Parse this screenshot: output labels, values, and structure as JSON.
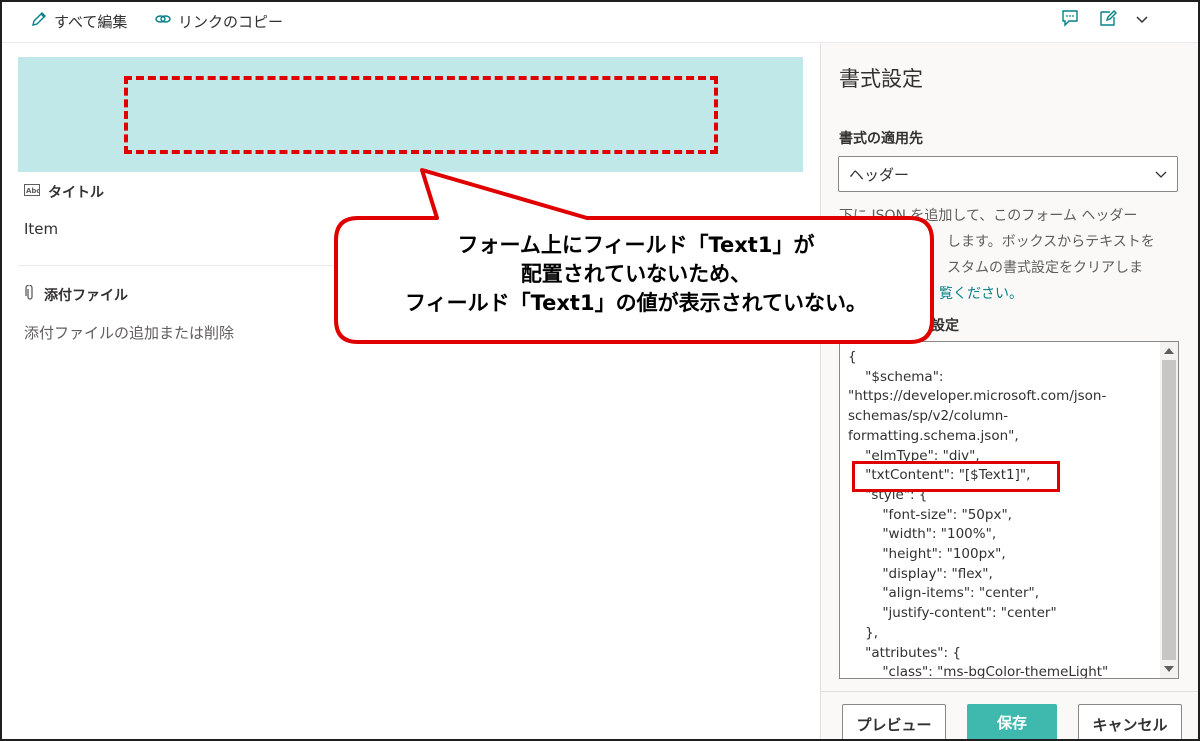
{
  "toolbar": {
    "edit_all_label": "すべて編集",
    "copy_link_label": "リンクのコピー"
  },
  "form": {
    "title_field": {
      "label": "タイトル",
      "value": "Item"
    },
    "attachments_field": {
      "label": "添付ファイル",
      "hint": "添付ファイルの追加または削除"
    }
  },
  "callout": {
    "lines": [
      "フォーム上にフィールド「Text1」が",
      "配置されていないため、",
      "フィールド「Text1」の値が表示されていない。"
    ]
  },
  "pane": {
    "title": "書式設定",
    "apply_to_label": "書式の適用先",
    "apply_to_value": "ヘッダー",
    "description": {
      "line1": "下に JSON を追加して、このフォーム ヘッダー",
      "line2": "します。ボックスからテキストを",
      "line3": "スタムの書式設定をクリアしま",
      "link": "覧ください。"
    },
    "json_label": "設定",
    "code_lines": [
      "{",
      "    \"$schema\":",
      "\"https://developer.microsoft.com/json-",
      "schemas/sp/v2/column-",
      "formatting.schema.json\",",
      "    \"elmType\": \"div\",",
      "    \"txtContent\": \"[$Text1]\",",
      "    \"style\": {",
      "        \"font-size\": \"50px\",",
      "        \"width\": \"100%\",",
      "        \"height\": \"100px\",",
      "        \"display\": \"flex\",",
      "        \"align-items\": \"center\",",
      "        \"justify-content\": \"center\"",
      "    },",
      "    \"attributes\": {",
      "        \"class\": \"ms-bgColor-themeLight\""
    ],
    "buttons": {
      "preview": "プレビュー",
      "save": "保存",
      "cancel": "キャンセル"
    }
  },
  "colors": {
    "header_band": "#c0e8e8",
    "highlight_red": "#e00000",
    "accent_teal": "#3fb8ae",
    "link_teal": "#038387"
  }
}
